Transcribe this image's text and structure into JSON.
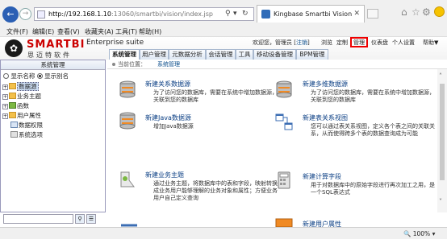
{
  "browser": {
    "url_host": "http://192.168.1.10",
    "url_path": ":13060/smartbi/vision/index.jsp",
    "tab_title": "Kingbase Smartbi Vision",
    "menu": [
      "文件(F)",
      "编辑(E)",
      "查看(V)",
      "收藏夹(A)",
      "工具(T)",
      "帮助(H)"
    ],
    "zoom": "100%"
  },
  "app": {
    "brand": "SMARTBI",
    "brand_cn": "思迈特软件",
    "suite": "Enterprise suite",
    "welcome": "欢迎您，管理员 [",
    "logout": "注销",
    "welcome_end": "]",
    "top_links": [
      "浏览",
      "定制",
      "管理",
      "仪表盘",
      "个人设置",
      "帮助▼"
    ],
    "nav_tabs": [
      "系统管理",
      "用户管理",
      "元数据分析",
      "会话管理",
      "工具",
      "移动设备管理",
      "BPM管理"
    ],
    "active_tab": "系统管理"
  },
  "left_panel": {
    "title": "系统管理",
    "radio_names": "显示名称",
    "radio_aliases": "显示别名",
    "tree": [
      "数据源",
      "业务主题",
      "函数",
      "用户属性",
      "数据权限",
      "系统选项"
    ]
  },
  "breadcrumb": {
    "label": "当前位置：",
    "current": "系统管理"
  },
  "cards": [
    {
      "title": "新建关系数据源",
      "desc": "为了访问您的数据库，需要在系统中增加数据源，关联到您的数据库"
    },
    {
      "title": "新建多维数据源",
      "desc": "为了访问您的数据库，需要在系统中增加数据源，关联到您的数据库"
    },
    {
      "title": "新建Java数据源",
      "desc": "增加Java数据源"
    },
    {
      "title": "新建表关系视图",
      "desc": "您可以通过表关系视图，定义各个表之间的关联关系，从而使得跨多个表的数据查询成为可能"
    },
    {
      "title": "新建业务主题",
      "desc": "通过业务主题，将数据库中的表和字段，映射转换成业务用户能够理解的业务对象和属性；方便业务用户自己定义查询"
    },
    {
      "title": "新建计算字段",
      "desc": "用于对数据库中的原始字段进行再次加工之用，是一个SQL表达式"
    },
    {
      "title": "新建用户属性",
      "desc": ""
    }
  ]
}
